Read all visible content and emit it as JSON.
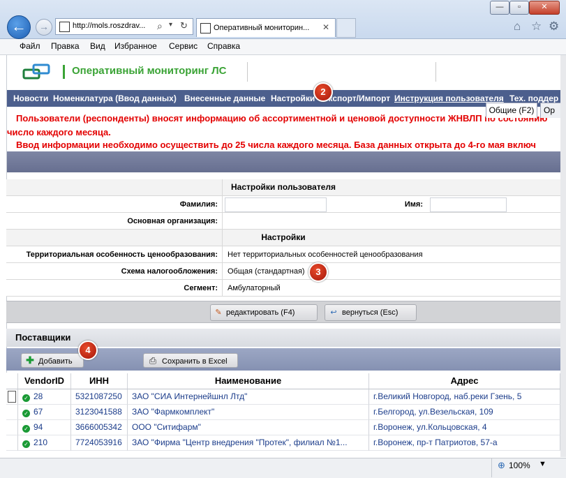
{
  "browser": {
    "address_text": "http://mols.roszdrav...",
    "tab_title": "Оперативный мониторин..."
  },
  "menu": [
    "Файл",
    "Правка",
    "Вид",
    "Избранное",
    "Сервис",
    "Справка"
  ],
  "site": {
    "logo_title": "Оперативный мониторинг ЛС"
  },
  "nav": [
    "Новости",
    "Номенклатура (Ввод данных)",
    "Внесенные данные",
    "Настройки",
    "Экспорт/Импорт",
    "Инструкция пользователя",
    "Тех. поддер"
  ],
  "notices": {
    "line1": "Пользователи (респонденты) вносят информацию об ассортиментной и ценовой доступности ЖНВЛП по состоянию",
    "line2": "число каждого месяца.",
    "line3": "Ввод информации необходимо осуществить до 25 числа каждого месяца. База данных открыта до 4-го мая включ"
  },
  "form_tabs": {
    "general": "Общие (F2)",
    "other": "Ор"
  },
  "settings": {
    "user_header": "Настройки пользователя",
    "surname_label": "Фамилия:",
    "surname_value": "",
    "name_label": "Имя:",
    "name_value": "",
    "org_label": "Основная организация:",
    "org_value": "",
    "section_header": "Настройки",
    "territorial_label": "Территориальная особенность ценообразования:",
    "territorial_value": "Нет территориальных особенностей ценообразования",
    "tax_label": "Схема налогообложения:",
    "tax_value": "Общая (стандартная)",
    "segment_label": "Сегмент:",
    "segment_value": "Амбулаторный"
  },
  "buttons": {
    "edit": "редактировать (F4)",
    "back": "вернуться (Esc)",
    "add": "Добавить",
    "excel": "Сохранить в Excel"
  },
  "suppliers": {
    "title": "Поставщики",
    "columns": [
      "VendorID",
      "ИНН",
      "Наименование",
      "Адрес"
    ],
    "rows": [
      {
        "id": "28",
        "inn": "5321087250",
        "name": "ЗАО \"СИА Интернейшнл Лтд\"",
        "address": "г.Великий Новгород, наб.реки Гзень, 5"
      },
      {
        "id": "67",
        "inn": "3123041588",
        "name": "ЗАО \"Фармкомплект\"",
        "address": "г.Белгород, ул.Везельская, 109"
      },
      {
        "id": "94",
        "inn": "3666005342",
        "name": "ООО \"Ситифарм\"",
        "address": "г.Воронеж, ул.Кольцовская, 4"
      },
      {
        "id": "210",
        "inn": "7724053916",
        "name": "ЗАО \"Фирма \"Центр внедрения \"Протек\", филиал №1...",
        "address": "г.Воронеж, пр-т Патриотов, 57-а"
      }
    ]
  },
  "badges": [
    "2",
    "3",
    "4"
  ],
  "status": {
    "zoom": "100%"
  }
}
